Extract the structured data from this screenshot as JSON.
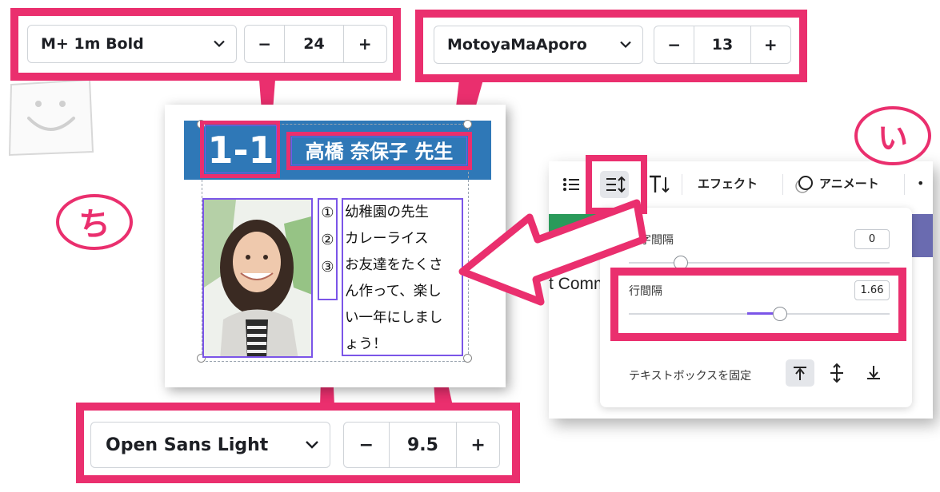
{
  "colors": {
    "accent": "#ea2f6e",
    "header_blue": "#2f78b7",
    "purple_select": "#7b55e8"
  },
  "toolbar_left": {
    "font_name": "M+ 1m Bold",
    "minus": "−",
    "size": "24",
    "plus": "+"
  },
  "toolbar_right": {
    "font_name": "MotoyaMaAporo",
    "minus": "−",
    "size": "13",
    "plus": "+"
  },
  "toolbar_bottom": {
    "font_name": "Open Sans Light",
    "minus": "−",
    "size": "9.5",
    "plus": "+"
  },
  "card": {
    "number": "1-1",
    "teacher_name": "高橋 奈保子 先生",
    "list_numbers": [
      "①",
      "②",
      "③"
    ],
    "body_lines": [
      "幼稚園の先生",
      "カレーライス",
      "お友達をたくさ",
      "ん作って、楽し",
      "い一年にしまし",
      "ょう！"
    ]
  },
  "annotations": {
    "left_circle": "ち",
    "right_circle": "い"
  },
  "editor_toolbar": {
    "effects_label": "エフェクト",
    "animate_label": "アニメート",
    "partial_text": "t Comm",
    "more_label": "•"
  },
  "spacing_popover": {
    "letter_spacing_label": "文字間隔",
    "letter_spacing_value": "0",
    "letter_spacing_level": 0.33,
    "line_spacing_label": "行間隔",
    "line_spacing_value": "1.66",
    "line_spacing_level": 0.58,
    "anchor_label": "テキストボックスを固定"
  }
}
